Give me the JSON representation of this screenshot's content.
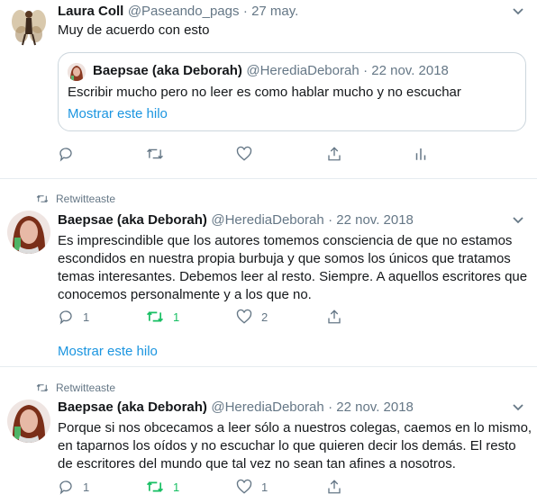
{
  "tweets": [
    {
      "name": "Laura Coll",
      "handle": "@Paseando_pags",
      "date": "· 27 may.",
      "text": "Muy de acuerdo con esto",
      "quote": {
        "name": "Baepsae (aka Deborah)",
        "handle": "@HerediaDeborah",
        "date": "· 22 nov. 2018",
        "text": "Escribir mucho pero no leer es como hablar  mucho y no escuchar",
        "link": "Mostrar este hilo"
      }
    },
    {
      "retweet_label": "Retwitteaste",
      "name": "Baepsae (aka Deborah)",
      "handle": "@HerediaDeborah",
      "date": "· 22 nov. 2018",
      "text_lines": [
        "Es imprescindible que los autores tomemos consciencia de que no estamos",
        "escondidos en nuestra propia burbuja y que somos los únicos que tratamos",
        "temas interesantes. Debemos leer al resto. Siempre. A aquellos escritores que",
        "conocemos personalmente y a los que no."
      ],
      "reply_count": "1",
      "retweet_count": "1",
      "like_count": "2",
      "link": "Mostrar este hilo"
    },
    {
      "retweet_label": "Retwitteaste",
      "name": "Baepsae (aka Deborah)",
      "handle": "@HerediaDeborah",
      "date": "· 22 nov. 2018",
      "text_lines": [
        "Porque si nos obcecamos a leer sólo a nuestros colegas, caemos en lo mismo,",
        "en taparnos los oídos y no escuchar lo que quieren decir los demás. El resto",
        "de escritores del mundo que tal vez no sean  tan afines a nosotros."
      ],
      "reply_count": "1",
      "retweet_count": "1",
      "like_count": "1"
    }
  ],
  "colors": {
    "retweeted_green": "#17bf63",
    "link_blue": "#1b95e0",
    "muted_gray": "#657786",
    "border": "#e6ecf0"
  }
}
